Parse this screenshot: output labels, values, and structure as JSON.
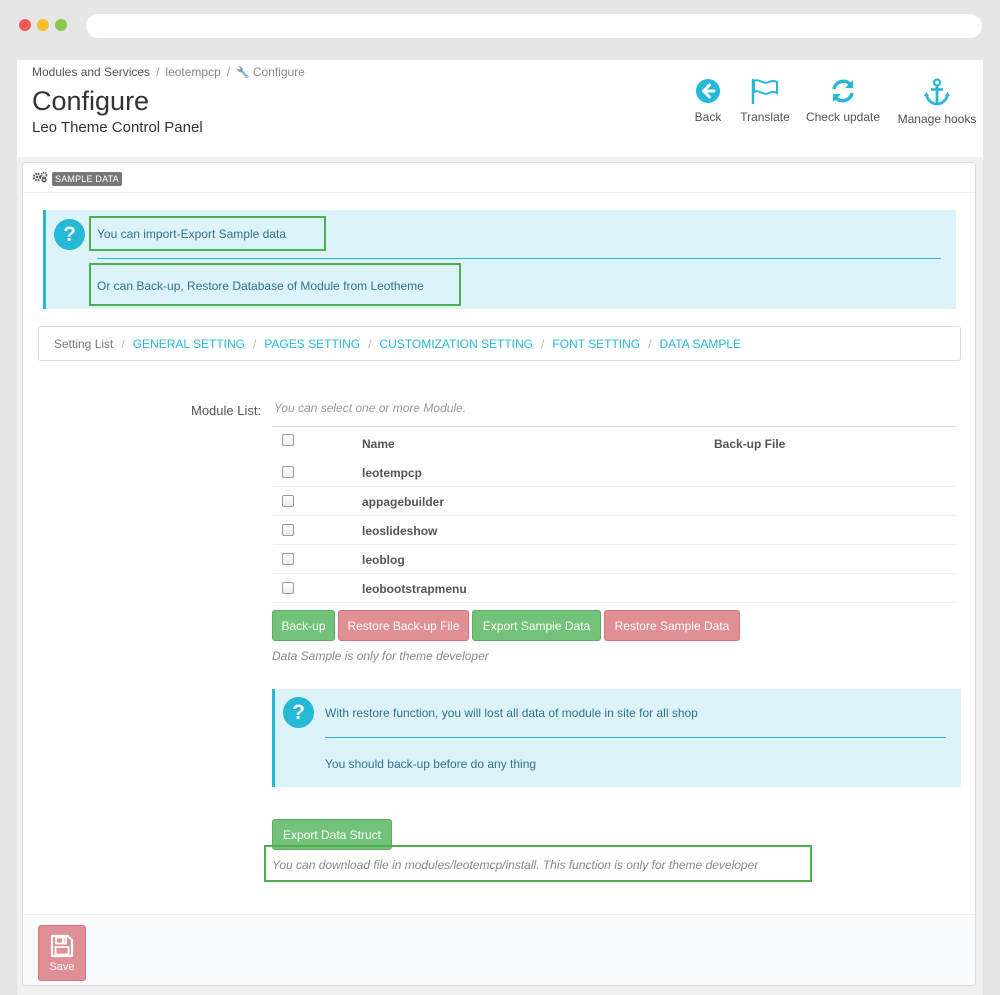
{
  "breadcrumb": {
    "items": [
      "Modules and Services",
      "leotempcp",
      "Configure"
    ]
  },
  "header": {
    "title": "Configure",
    "subtitle": "Leo Theme Control Panel"
  },
  "toolbar": {
    "back": "Back",
    "translate": "Translate",
    "check_update": "Check update",
    "manage_hooks": "Manage hooks"
  },
  "panel": {
    "heading": "SAMPLE DATA"
  },
  "alert_top": {
    "line1": "You can import-Export Sample data",
    "line2": "Or can Back-up, Restore Database of Module from Leotheme"
  },
  "tabs": [
    "Setting List",
    "GENERAL SETTING",
    "PAGES SETTING",
    "CUSTOMIZATION SETTING",
    "FONT SETTING",
    "DATA SAMPLE"
  ],
  "module_list": {
    "label": "Module List:",
    "hint": "You can select one or more Module.",
    "columns": [
      "Name",
      "Back-up File"
    ],
    "rows": [
      "leotempcp",
      "appagebuilder",
      "leoslideshow",
      "leoblog",
      "leobootstrapmenu"
    ]
  },
  "buttons": {
    "backup": "Back-up",
    "restore_backup": "Restore Back-up File",
    "export_sample": "Export Sample Data",
    "restore_sample": "Restore Sample Data",
    "export_struct": "Export Data Struct",
    "save": "Save"
  },
  "notes": {
    "dev_only": "Data Sample is only for theme developer",
    "download": "You can download file in modules/leotemcp/install. This function is only for theme developer"
  },
  "alert_mid": {
    "line1": "With restore function, you will lost all data of module in site for all shop",
    "line2": "You should back-up before do any thing"
  },
  "colors": {
    "accent": "#25b9d7",
    "success": "#72c279",
    "danger": "#e08f95",
    "highlight": "#4caf50"
  }
}
